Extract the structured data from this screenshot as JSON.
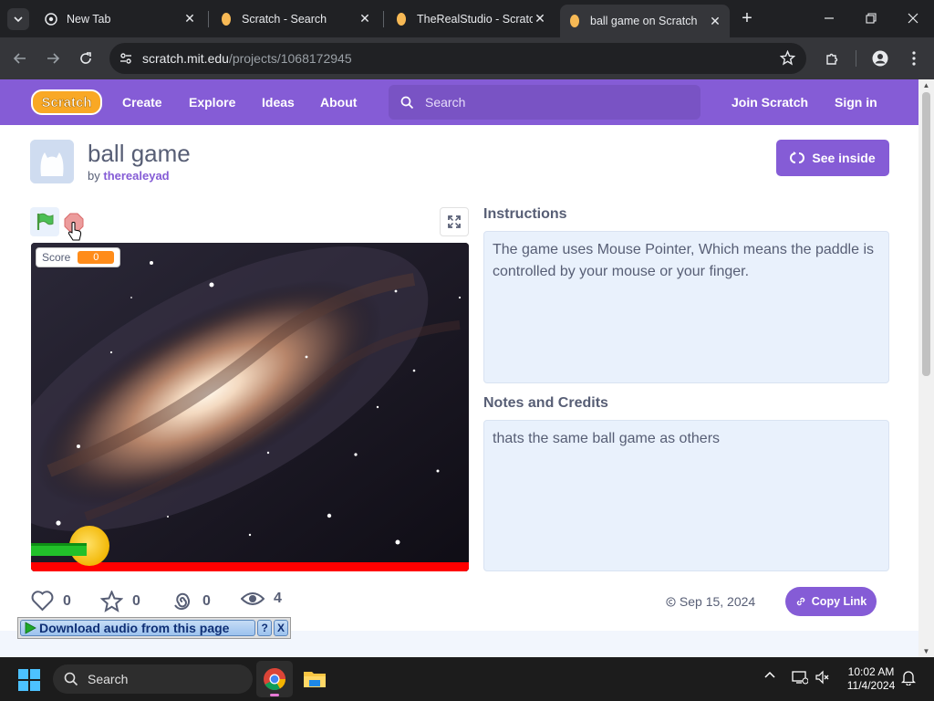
{
  "browser": {
    "tabs": [
      {
        "title": "New Tab",
        "close": "✕"
      },
      {
        "title": "Scratch - Search",
        "close": "✕"
      },
      {
        "title": "TheRealStudio - Scratch",
        "close": "✕"
      },
      {
        "title": "ball game on Scratch",
        "close": "✕",
        "active": true
      }
    ],
    "url_host": "scratch.mit.edu",
    "url_path": "/projects/1068172945"
  },
  "scratch_nav": {
    "logo_text": "Scratch",
    "links": [
      "Create",
      "Explore",
      "Ideas",
      "About"
    ],
    "search_placeholder": "Search",
    "join": "Join Scratch",
    "signin": "Sign in"
  },
  "project": {
    "title": "ball game",
    "by_label": "by",
    "author": "therealeyad",
    "see_inside": "See inside",
    "score_label": "Score",
    "score_value": "0",
    "instructions_title": "Instructions",
    "instructions": "The game uses Mouse Pointer, Which means the paddle is controlled by your mouse or your finger.",
    "notes_title": "Notes and Credits",
    "notes": "thats the same ball game as others",
    "stats": {
      "loves": "0",
      "favorites": "0",
      "remixes": "0",
      "views": "4"
    },
    "date": "Sep 15, 2024",
    "copy_link": "Copy Link"
  },
  "download_bar": {
    "label": "Download audio from this page",
    "help": "?",
    "close": "X"
  },
  "taskbar": {
    "search_placeholder": "Search",
    "time": "10:02 AM",
    "date": "11/4/2024"
  },
  "colors": {
    "scratch_purple": "#855cd6",
    "text": "#575e75",
    "box_bg": "#e9f1fc",
    "score_orange": "#ff8c1a"
  }
}
